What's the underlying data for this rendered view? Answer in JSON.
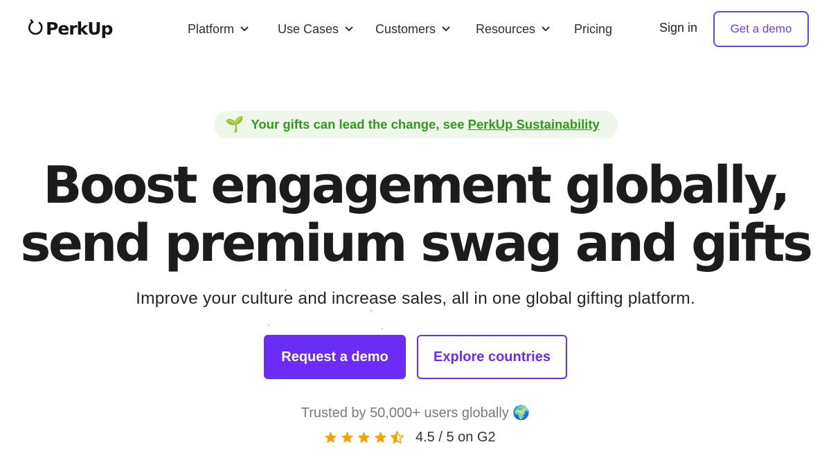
{
  "header": {
    "logo_text": "PerkUp",
    "nav": [
      {
        "label": "Platform",
        "has_dropdown": true
      },
      {
        "label": "Use Cases",
        "has_dropdown": true
      },
      {
        "label": "Customers",
        "has_dropdown": true
      },
      {
        "label": "Resources",
        "has_dropdown": true
      },
      {
        "label": "Pricing",
        "has_dropdown": false
      }
    ],
    "signin_label": "Sign in",
    "demo_label": "Get a demo",
    "accent_color": "#6b3ef5"
  },
  "banner": {
    "icon": "sprout-icon",
    "text": "Your gifts can lead the change, see ",
    "link_text": "PerkUp Sustainability",
    "color": "#2f9b1d"
  },
  "hero": {
    "headline_line1": "Boost engagement globally,",
    "headline_line2": "send premium swag and gifts",
    "subheadline": "Improve your culture and increase sales, all in one global gifting platform.",
    "primary_cta": "Request a demo",
    "secondary_cta": "Explore countries",
    "trusted_text": "Trusted by 50,000+ users globally",
    "trusted_icon": "globe-icon",
    "rating_text": "4.5 / 5 on G2",
    "rating_value": 4.5,
    "rating_max": 5,
    "star_color": "#f5a300"
  }
}
